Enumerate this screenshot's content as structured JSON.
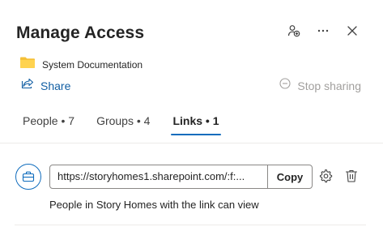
{
  "header": {
    "title": "Manage Access",
    "icons": [
      "share-people-icon",
      "more-icon",
      "close-icon"
    ]
  },
  "document": {
    "name": "System Documentation",
    "icon": "folder-icon"
  },
  "actions": {
    "share_label": "Share",
    "stop_sharing_label": "Stop sharing"
  },
  "tabs": [
    {
      "label": "People • 7",
      "active": false
    },
    {
      "label": "Groups • 4",
      "active": false
    },
    {
      "label": "Links • 1",
      "active": true
    }
  ],
  "link": {
    "url": "https://storyhomes1.sharepoint.com/:f:...",
    "copy_label": "Copy",
    "description": "People in Story Homes with the link can view"
  },
  "colors": {
    "accent": "#0f6cbd",
    "link_text": "#115ea3",
    "folder": "#f5c037",
    "disabled": "#a19f9d"
  }
}
